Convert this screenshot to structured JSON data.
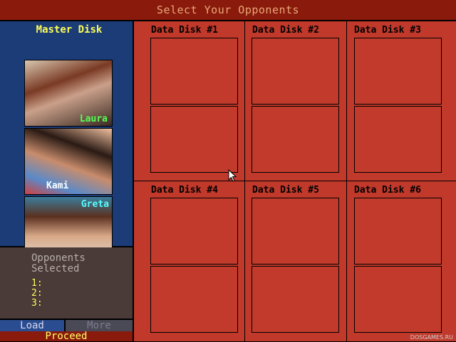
{
  "title": "Select Your Opponents",
  "master": {
    "title": "Master Disk",
    "opponents": [
      {
        "name": "Laura",
        "name_color": "#55ff55"
      },
      {
        "name": "Kami",
        "name_color": "#ffffff"
      },
      {
        "name": "Greta",
        "name_color": "#55ffff"
      }
    ]
  },
  "selected": {
    "title_line1": "Opponents",
    "title_line2": "Selected",
    "slots": [
      "1:",
      "2:",
      "3:"
    ]
  },
  "buttons": {
    "load": "Load",
    "more": "More",
    "proceed": "Proceed"
  },
  "data_disks": [
    {
      "title": "Data Disk #1"
    },
    {
      "title": "Data Disk #2"
    },
    {
      "title": "Data Disk #3"
    },
    {
      "title": "Data Disk #4"
    },
    {
      "title": "Data Disk #5"
    },
    {
      "title": "Data Disk #6"
    }
  ],
  "watermark": "DOSGAMES.RU",
  "colors": {
    "accent": "#ffff55",
    "panel_blue": "#1c3c78",
    "disk_red": "#c0392b"
  }
}
